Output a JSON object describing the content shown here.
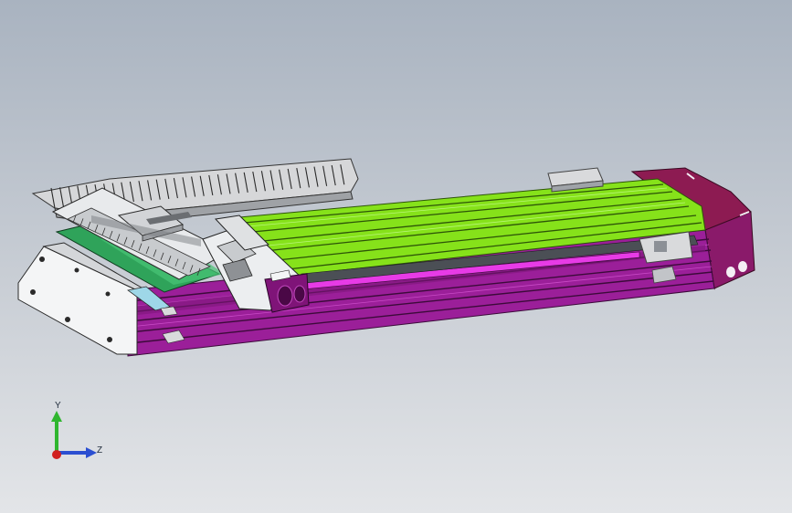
{
  "viewport": {
    "background_top": "#a9b3c0",
    "background_bottom": "#e3e5e8"
  },
  "model": {
    "parts": [
      {
        "name": "base-extrusion",
        "color": "#9b1f99"
      },
      {
        "name": "top-rails",
        "color": "#86e21a"
      },
      {
        "name": "end-cap",
        "color": "#8d1b52"
      },
      {
        "name": "cable-chain",
        "color": "#d6d7d9"
      },
      {
        "name": "carriage",
        "color": "#e8eaec"
      },
      {
        "name": "motor-plate",
        "color": "#f2f2f2"
      },
      {
        "name": "green-bracket",
        "color": "#2fa35a"
      }
    ]
  },
  "triad": {
    "y_label": "Y",
    "z_label": "Z",
    "y_color": "#2fb62f",
    "z_color": "#2b4fd1",
    "x_color": "#d11f1f"
  }
}
